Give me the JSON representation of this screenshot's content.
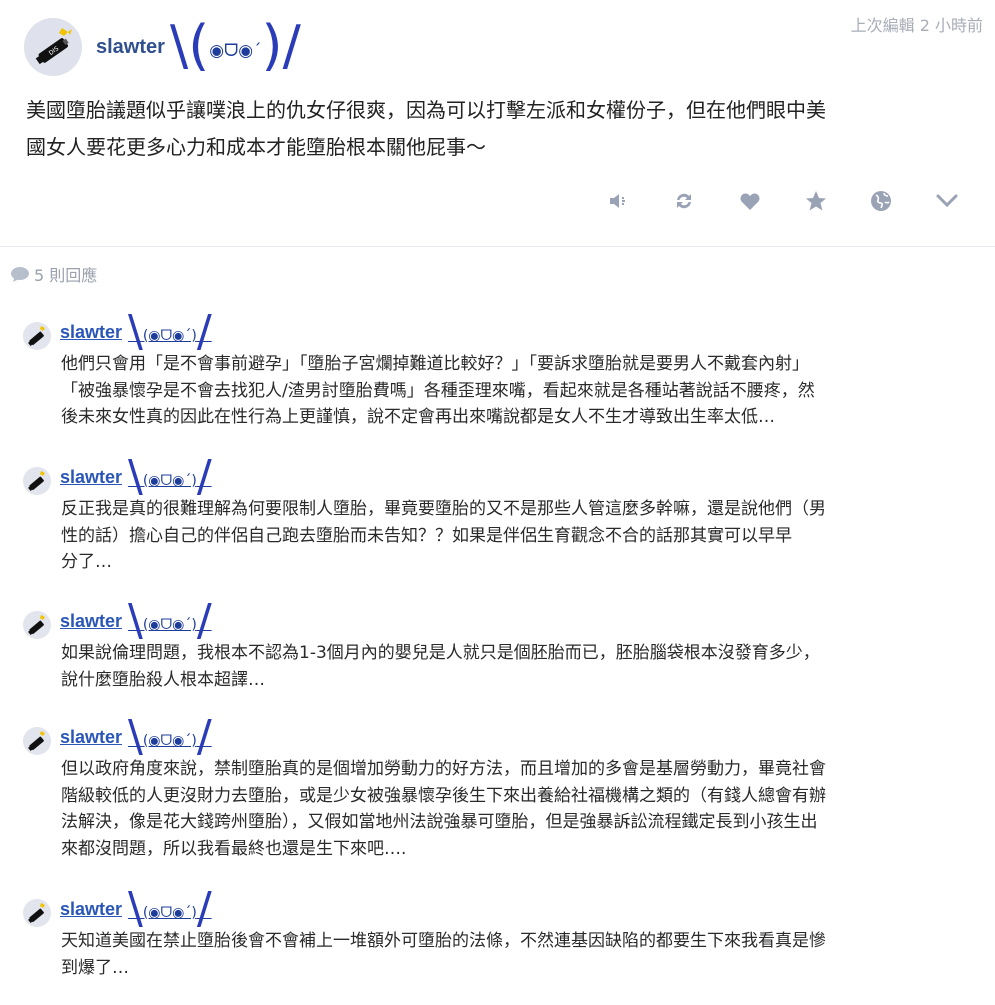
{
  "post": {
    "author": "slawter",
    "emoticon_left": "\\(",
    "emoticon_face": "◉ᗜ◉´",
    "emoticon_right": ")/",
    "time": "上次編輯 2 小時前",
    "content_line1": "美國墮胎議題似乎讓噗浪上的仇女仔很爽，因為可以打擊左派和女權份子，但在他們眼中美",
    "content_line2": "國女人要花更多心力和成本才能墮胎根本關他屁事～",
    "actions": [
      "mute-icon",
      "replurk-icon",
      "like-icon",
      "favorite-icon",
      "globe-icon",
      "chevron-down-icon"
    ]
  },
  "responses": {
    "count_label": "5 則回應"
  },
  "replies": [
    {
      "author": "slawter",
      "emoticon": "(◉ᗜ◉´)",
      "lines": [
        "他們只會用「是不會事前避孕」「墮胎子宮爛掉難道比較好？」「要訴求墮胎就是要男人不戴套內射」",
        "「被強暴懷孕是不會去找犯人/渣男討墮胎費嗎」各種歪理來嘴，看起來就是各種站著說話不腰疼，然",
        "後未來女性真的因此在性行為上更謹慎，說不定會再出來嘴說都是女人不生才導致出生率太低…"
      ]
    },
    {
      "author": "slawter",
      "emoticon": "(◉ᗜ◉´)",
      "lines": [
        "反正我是真的很難理解為何要限制人墮胎，畢竟要墮胎的又不是那些人管這麼多幹嘛，還是說他們（男",
        "性的話）擔心自己的伴侶自己跑去墮胎而未告知？？如果是伴侶生育觀念不合的話那其實可以早早",
        "分了…"
      ]
    },
    {
      "author": "slawter",
      "emoticon": "(◉ᗜ◉´)",
      "lines": [
        "如果說倫理問題，我根本不認為1-3個月內的嬰兒是人就只是個胚胎而已，胚胎腦袋根本沒發育多少，",
        "說什麼墮胎殺人根本超譯…"
      ]
    },
    {
      "author": "slawter",
      "emoticon": "(◉ᗜ◉´)",
      "lines": [
        "但以政府角度來說，禁制墮胎真的是個增加勞動力的好方法，而且增加的多會是基層勞動力，畢竟社會",
        "階級較低的人更沒財力去墮胎，或是少女被強暴懷孕後生下來出養給社福機構之類的（有錢人總會有辦",
        "法解決，像是花大錢跨州墮胎），又假如當地州法說強暴可墮胎，但是強暴訴訟流程鐵定長到小孩生出",
        "來都沒問題，所以我看最終也還是生下來吧…."
      ]
    },
    {
      "author": "slawter",
      "emoticon": "(◉ᗜ◉´)",
      "lines": [
        "天知道美國在禁止墮胎後會不會補上一堆額外可墮胎的法條，不然連基因缺陷的都要生下來我看真是慘",
        "到爆了…"
      ]
    }
  ]
}
